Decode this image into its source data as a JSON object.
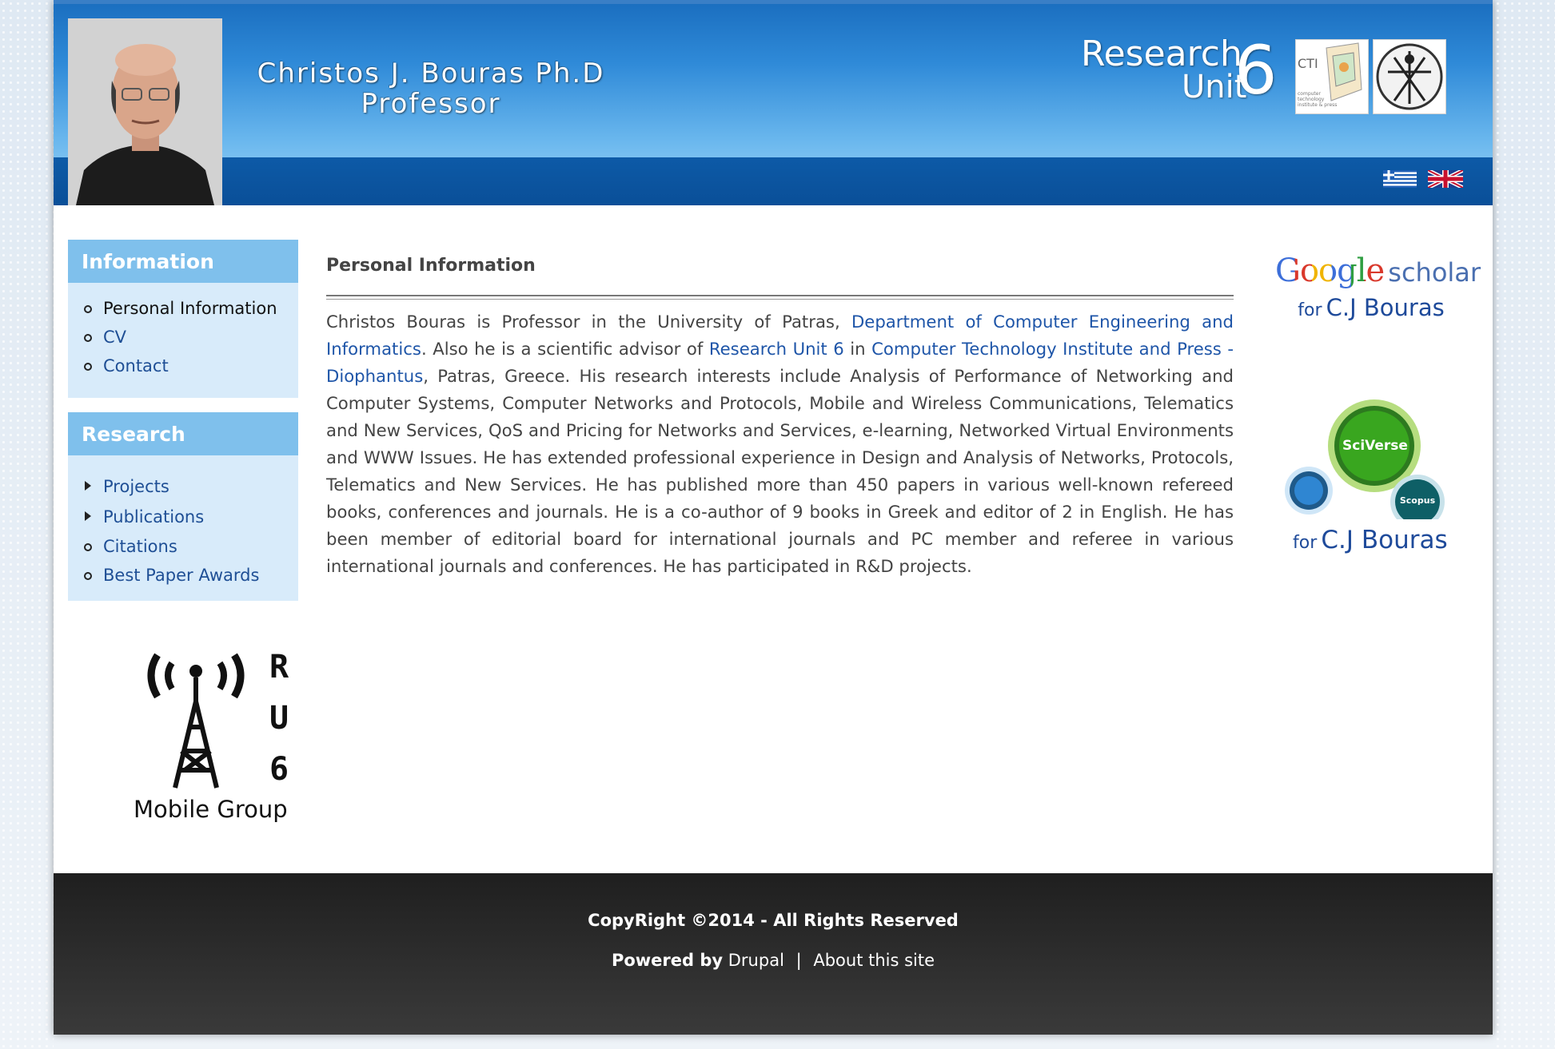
{
  "header": {
    "name_line1": "Christos J. Bouras Ph.D",
    "name_line2": "Professor",
    "unit_logo": {
      "word1": "Research",
      "word2": "Unit",
      "number": "6"
    },
    "cti_logo": {
      "abbr": "CTI",
      "subtitle": "computer technology institute & press"
    },
    "languages": [
      "greek-flag",
      "uk-flag"
    ]
  },
  "sidebar": {
    "information": {
      "title": "Information",
      "items": [
        "Personal Information",
        "CV",
        "Contact"
      ]
    },
    "research": {
      "title": "Research",
      "items": [
        "Projects",
        "Publications",
        "Citations",
        "Best Paper Awards"
      ]
    },
    "mobile_group_logo": {
      "letters": [
        "R",
        "U",
        "6"
      ],
      "label": "Mobile Group"
    }
  },
  "main": {
    "title": "Personal Information",
    "p_seg1": "Christos Bouras is Professor in the University of Patras, ",
    "link_dept": "Department of Computer Engineering and Informatics",
    "p_seg2": ". Also he is a scientific advisor of ",
    "link_ru6": "Research Unit 6",
    "p_seg3": " in ",
    "link_cti": "Computer Technology Institute and Press - Diophantus",
    "p_seg4": ", Patras, Greece. His research interests include Analysis of Performance of Networking and Computer Systems, Computer Networks and Protocols, Mobile and Wireless Communications, Telematics and New Services, QoS and Pricing for Networks and Services, e-learning, Networked Virtual Environments and WWW Issues. He has extended professional experience in Design and Analysis of Networks, Protocols, Telematics and New Services. He has published more than 450 papers in various well-known refereed books, conferences and journals. He is a co-author of 9 books in Greek and editor of 2 in English. He has been member of editorial board for international journals and PC member and referee in various international journals and conferences. He has participated in R&D projects."
  },
  "right": {
    "scholar": {
      "brand": "Google",
      "product": "scholar",
      "for": "for",
      "person": "C.J Bouras"
    },
    "sciverse": {
      "brand": "SciVerse",
      "sub": "Scopus",
      "for": "for",
      "person": "C.J Bouras"
    }
  },
  "footer": {
    "copyright": "CopyRight ©2014 - All Rights Reserved",
    "powered_by": "Powered by",
    "drupal": "Drupal",
    "separator": "|",
    "about": "About this site"
  },
  "colors": {
    "header_blue": "#2f8ad8",
    "sidebar_head": "#7fc0ec",
    "sidebar_bg": "#d8ebfa",
    "link": "#1e55a8",
    "footer": "#2a2a2a"
  }
}
